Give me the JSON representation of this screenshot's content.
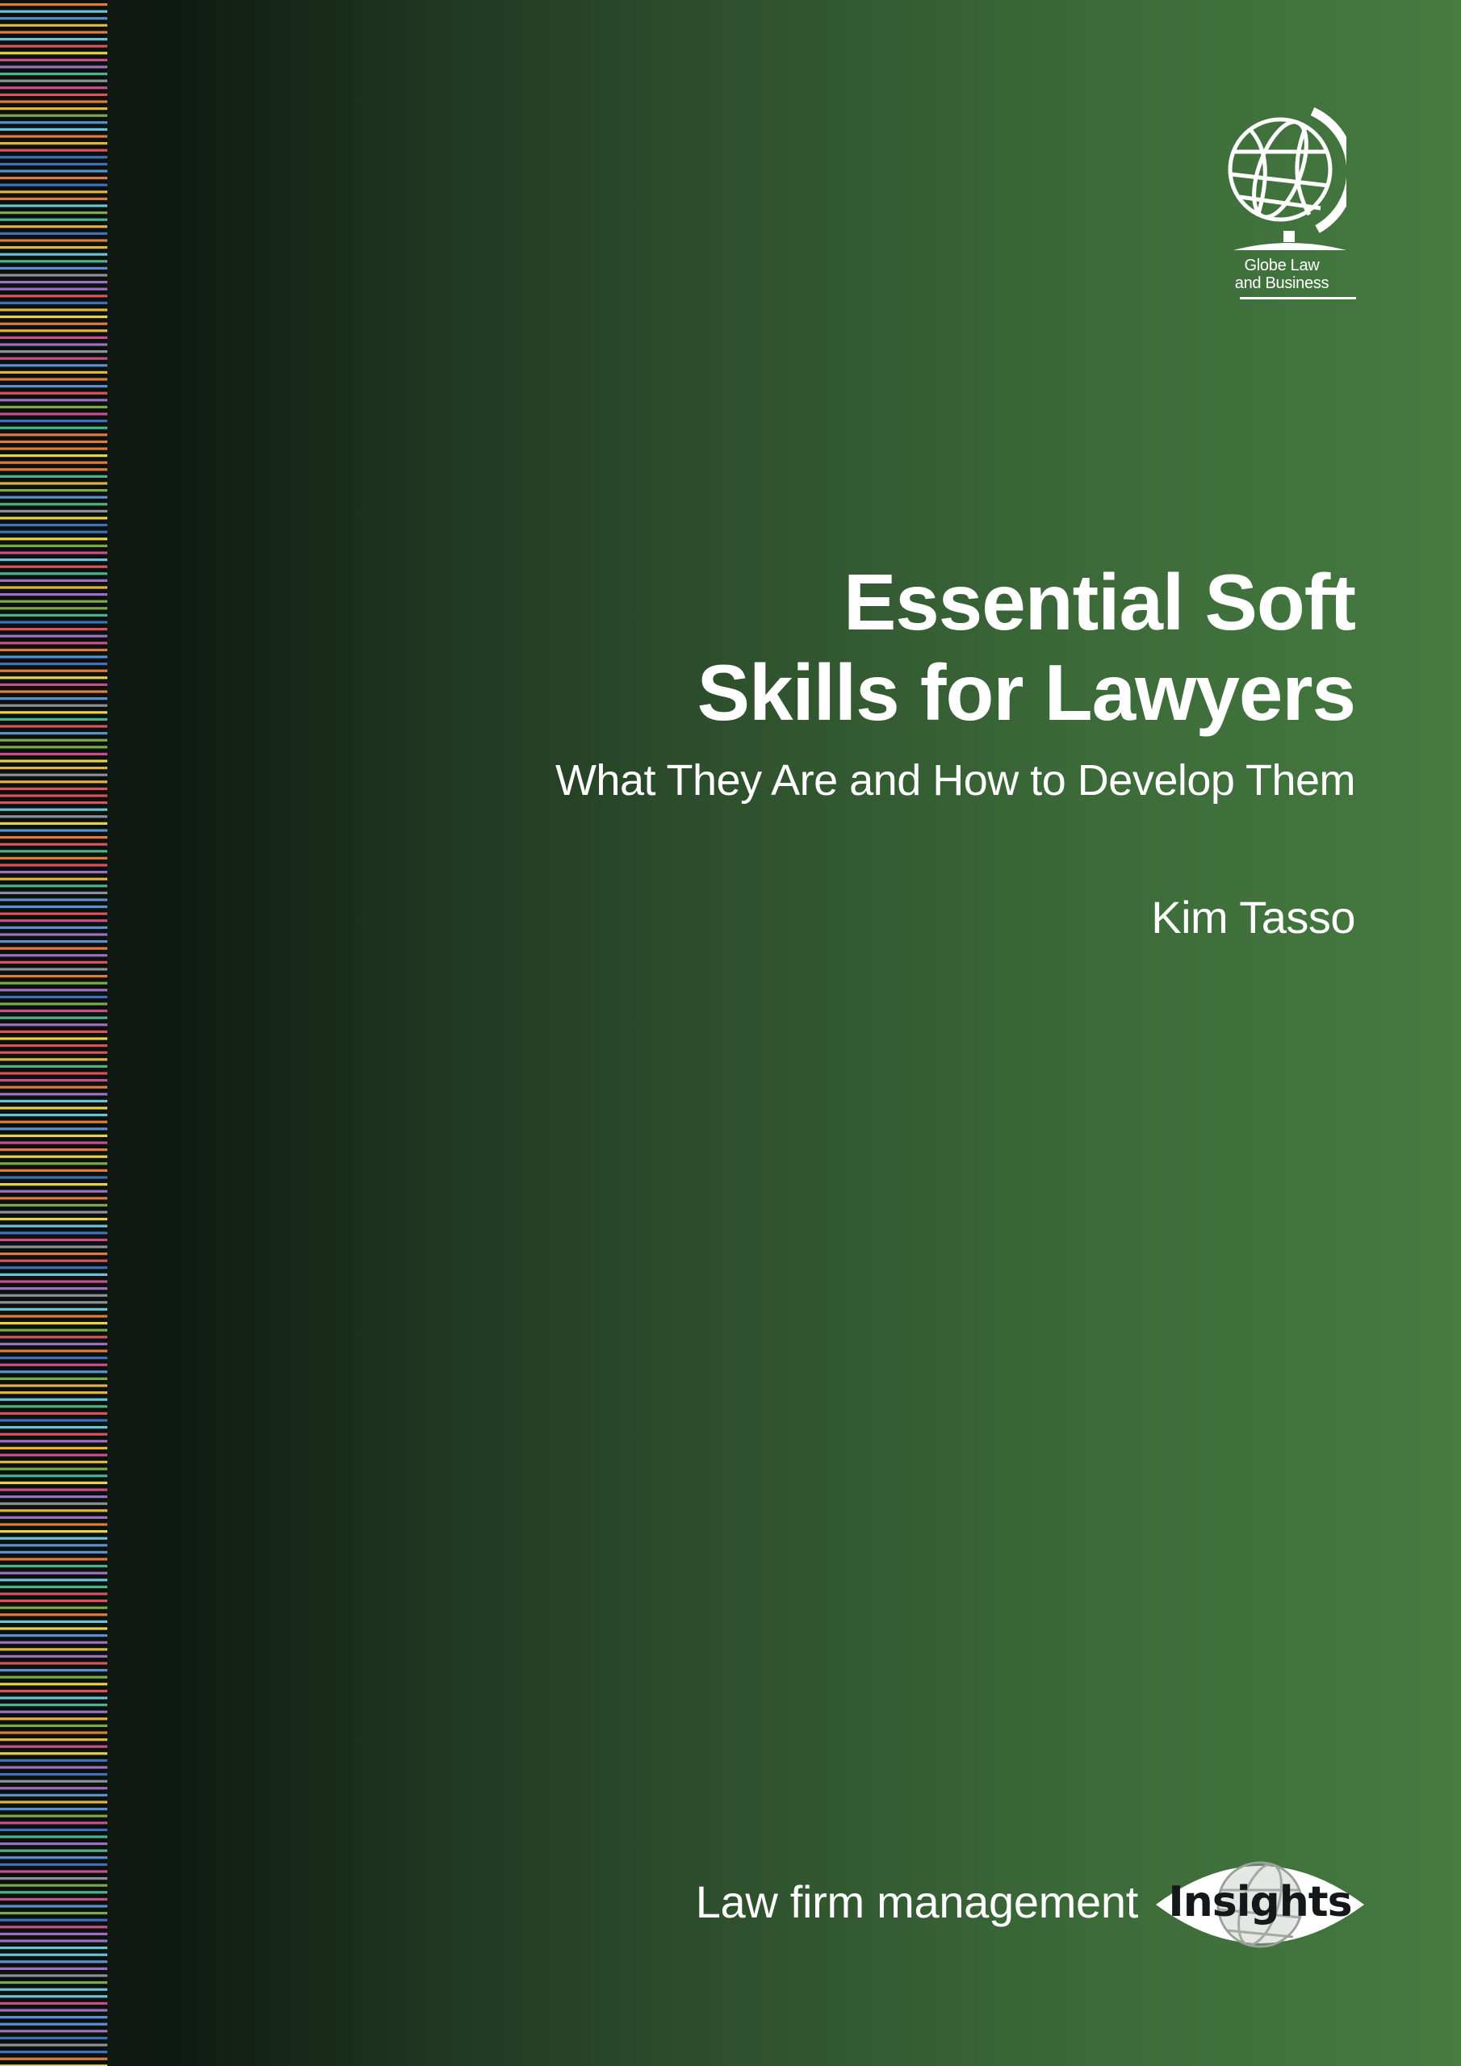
{
  "cover": {
    "title_line_1": "Essential Soft",
    "title_line_2": "Skills for Lawyers",
    "subtitle": "What They Are and How to Develop Them",
    "author": "Kim Tasso"
  },
  "publisher": {
    "line_1": "Globe Law",
    "line_2": "and Business",
    "icon": "globe-icon"
  },
  "series": {
    "label": "Law firm management",
    "badge": "Insights"
  },
  "colors": {
    "background_dark": "#0e1510",
    "background_green": "#467b41",
    "text": "#ffffff",
    "badge_text": "#15181a"
  }
}
